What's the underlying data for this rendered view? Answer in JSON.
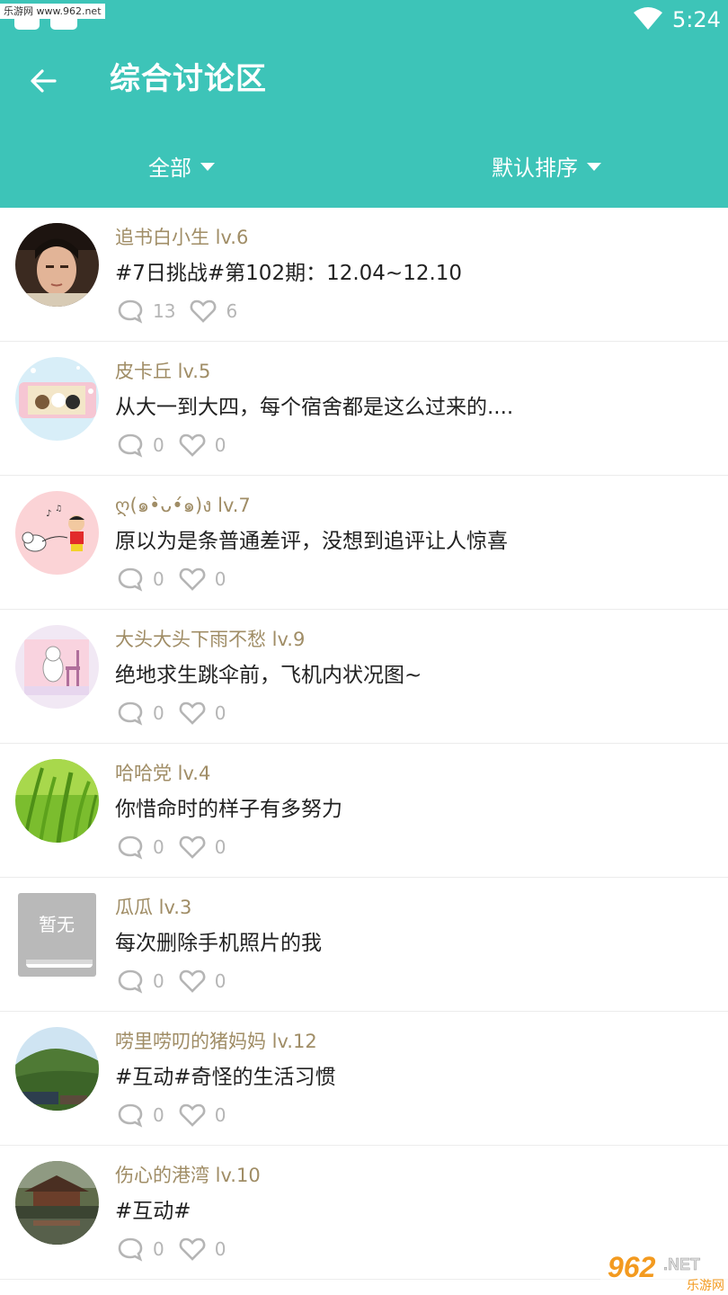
{
  "status_bar": {
    "watermark": "乐游网 www.962.net",
    "time": "5:24",
    "wifi_icon": "wifi-icon"
  },
  "header": {
    "back_icon": "back-arrow-icon",
    "title": "综合讨论区",
    "filter_all": "全部",
    "filter_sort": "默认排序",
    "accent_color": "#3dc4b8"
  },
  "posts": [
    {
      "author": "追书白小生 lv.6",
      "title": "#7日挑战#第102期：12.04~12.10",
      "comments": "13",
      "likes": "6",
      "avatar": "avatar-photo-man"
    },
    {
      "author": "皮卡丘 lv.5",
      "title": "从大一到大四，每个宿舍都是这么过来的....",
      "comments": "0",
      "likes": "0",
      "avatar": "avatar-cartoon-bears"
    },
    {
      "author": "ღ(๑•̀ᴗ•́๑)ง lv.7",
      "title": "原以为是条普通差评，没想到追评让人惊喜",
      "comments": "0",
      "likes": "0",
      "avatar": "avatar-cartoon-boy-dog"
    },
    {
      "author": "大头大头下雨不愁 lv.9",
      "title": "绝地求生跳伞前，飞机内状况图~",
      "comments": "0",
      "likes": "0",
      "avatar": "avatar-cartoon-bear-chair"
    },
    {
      "author": "哈哈党 lv.4",
      "title": "你惜命时的样子有多努力",
      "comments": "0",
      "likes": "0",
      "avatar": "avatar-green-grass"
    },
    {
      "author": "瓜瓜 lv.3",
      "title": "每次删除手机照片的我",
      "comments": "0",
      "likes": "0",
      "avatar": "avatar-placeholder",
      "avatar_text": "暂无"
    },
    {
      "author": "唠里唠叨的猪妈妈 lv.12",
      "title": "#互动#奇怪的生活习惯",
      "comments": "0",
      "likes": "0",
      "avatar": "avatar-landscape-hill"
    },
    {
      "author": "伤心的港湾 lv.10",
      "title": "#互动#",
      "comments": "0",
      "likes": "0",
      "avatar": "avatar-landscape-pavilion"
    }
  ],
  "watermark_br": {
    "main": "962",
    "suffix": ".NET",
    "sub": "乐游网"
  },
  "colors": {
    "author": "#a08d66",
    "title": "#222222",
    "stats": "#b5b5b5"
  }
}
